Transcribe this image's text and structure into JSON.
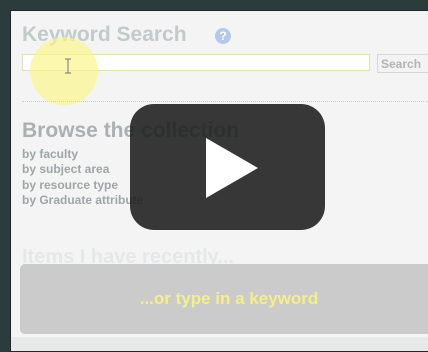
{
  "search": {
    "title": "Keyword Search",
    "help_icon": "question-icon",
    "help_glyph": "?",
    "input_value": "",
    "button_label": "Search"
  },
  "browse": {
    "title": "Browse the collection",
    "items": [
      {
        "label": "by faculty"
      },
      {
        "label": "by subject area"
      },
      {
        "label": "by resource type"
      },
      {
        "label": "by Graduate attribute"
      }
    ]
  },
  "recent": {
    "title": "Items I have recently..."
  },
  "banner": {
    "text": "...or type in a keyword"
  },
  "video": {
    "play_icon": "play-icon"
  },
  "colors": {
    "highlight": "#f6f06a",
    "banner_text": "#f3ee72",
    "play_overlay": "#1c1c1c"
  }
}
